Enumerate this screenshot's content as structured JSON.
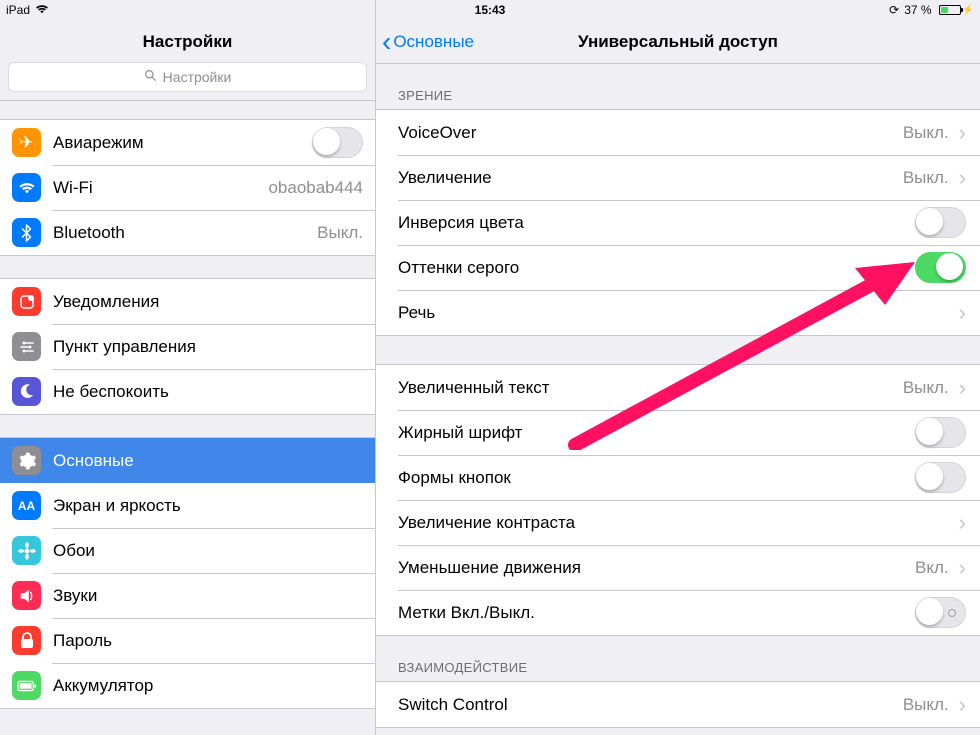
{
  "statusbar": {
    "device": "iPad",
    "time": "15:43",
    "battery_pct": "37 %"
  },
  "sidebar": {
    "title": "Настройки",
    "search_placeholder": "Настройки",
    "groups": [
      {
        "rows": [
          {
            "label": "Авиарежим",
            "icon": "airplane",
            "bg": "#ff9500",
            "type": "toggle",
            "on": false
          },
          {
            "label": "Wi-Fi",
            "icon": "wifi",
            "bg": "#007aff",
            "type": "detail",
            "detail": "obaobab444"
          },
          {
            "label": "Bluetooth",
            "icon": "bluetooth",
            "bg": "#007aff",
            "type": "detail",
            "detail": "Выкл."
          }
        ]
      },
      {
        "rows": [
          {
            "label": "Уведомления",
            "icon": "notifications",
            "bg": "#ff3b30",
            "type": "link"
          },
          {
            "label": "Пункт управления",
            "icon": "control-center",
            "bg": "#8e8e93",
            "type": "link"
          },
          {
            "label": "Не беспокоить",
            "icon": "dnd",
            "bg": "#5856d6",
            "type": "link"
          }
        ]
      },
      {
        "rows": [
          {
            "label": "Основные",
            "icon": "general",
            "bg": "#8e8e93",
            "type": "link",
            "selected": true
          },
          {
            "label": "Экран и яркость",
            "icon": "display",
            "bg": "#007aff",
            "type": "link"
          },
          {
            "label": "Обои",
            "icon": "wallpaper",
            "bg": "#36c7dc",
            "type": "link"
          },
          {
            "label": "Звуки",
            "icon": "sounds",
            "bg": "#ff2d55",
            "type": "link"
          },
          {
            "label": "Пароль",
            "icon": "passcode",
            "bg": "#ff3b30",
            "type": "link"
          },
          {
            "label": "Аккумулятор",
            "icon": "battery",
            "bg": "#4cd964",
            "type": "link"
          }
        ]
      }
    ]
  },
  "detail": {
    "back_label": "Основные",
    "title": "Универсальный доступ",
    "sections": [
      {
        "header": "ЗРЕНИЕ",
        "rows": [
          {
            "label": "VoiceOver",
            "type": "disclose",
            "detail": "Выкл."
          },
          {
            "label": "Увеличение",
            "type": "disclose",
            "detail": "Выкл."
          },
          {
            "label": "Инверсия цвета",
            "type": "toggle",
            "on": false
          },
          {
            "label": "Оттенки серого",
            "type": "toggle",
            "on": true
          },
          {
            "label": "Речь",
            "type": "disclose",
            "detail": ""
          }
        ]
      },
      {
        "header": "",
        "rows": [
          {
            "label": "Увеличенный текст",
            "type": "disclose",
            "detail": "Выкл."
          },
          {
            "label": "Жирный шрифт",
            "type": "toggle",
            "on": false
          },
          {
            "label": "Формы кнопок",
            "type": "toggle",
            "on": false
          },
          {
            "label": "Увеличение контраста",
            "type": "disclose",
            "detail": ""
          },
          {
            "label": "Уменьшение движения",
            "type": "disclose",
            "detail": "Вкл."
          },
          {
            "label": "Метки Вкл./Выкл.",
            "type": "toggle",
            "on": false,
            "marks": true
          }
        ]
      },
      {
        "header": "ВЗАИМОДЕЙСТВИЕ",
        "rows": [
          {
            "label": "Switch Control",
            "type": "disclose",
            "detail": "Выкл."
          }
        ]
      }
    ]
  },
  "icons": {
    "airplane": "✈",
    "wifi": "wifi",
    "bluetooth": "bt",
    "notifications": "notif",
    "control-center": "cc",
    "dnd": "🌙",
    "general": "⚙",
    "display": "AA",
    "wallpaper": "❀",
    "sounds": "🔊",
    "passcode": "lock",
    "battery": "🔋"
  }
}
